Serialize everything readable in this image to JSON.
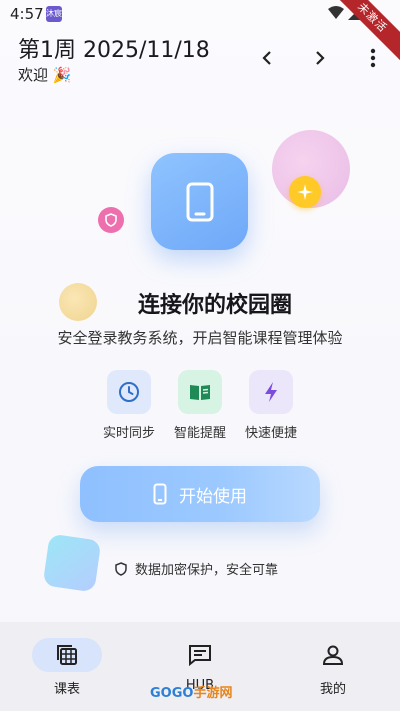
{
  "status": {
    "time": "4:57",
    "app_badge": "沐宸",
    "ribbon": "未激活"
  },
  "header": {
    "week_title": "第1周 2025/11/18",
    "welcome": "欢迎 🎉"
  },
  "hero": {
    "title": "连接你的校园圈",
    "subtitle": "安全登录教务系统，开启智能课程管理体验"
  },
  "features": [
    {
      "label": "实时同步",
      "icon": "clock-icon",
      "bg": "#dfe9fb",
      "color": "#2f6fc8"
    },
    {
      "label": "智能提醒",
      "icon": "book-icon",
      "bg": "#d7f3e4",
      "color": "#1f8a55"
    },
    {
      "label": "快速便捷",
      "icon": "bolt-icon",
      "bg": "#ece6fb",
      "color": "#7a4de0"
    }
  ],
  "start_button": {
    "label": "开始使用"
  },
  "secure_note": "数据加密保护，安全可靠",
  "bottom_nav": [
    {
      "label": "课表",
      "icon": "calendar-grid-icon",
      "active": true
    },
    {
      "label": "HUB",
      "icon": "chat-icon",
      "active": false
    },
    {
      "label": "我的",
      "icon": "person-icon",
      "active": false
    }
  ],
  "watermark": {
    "left": "GOGO",
    "right": "手游网"
  },
  "colors": {
    "accent": "#8fc0ff",
    "ribbon": "#b5262a",
    "pink": "#ee6fae",
    "star": "#ffc928"
  }
}
